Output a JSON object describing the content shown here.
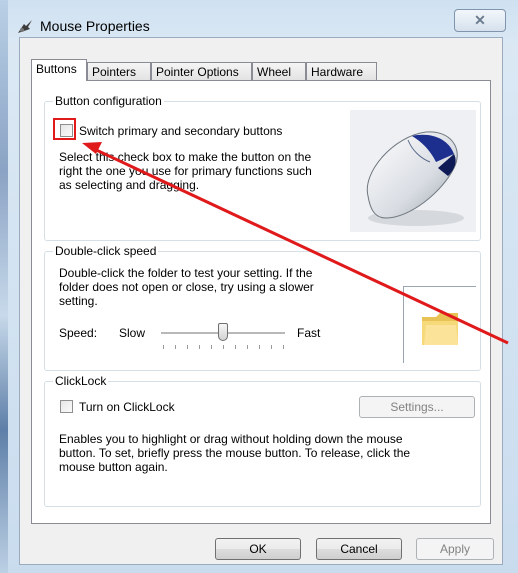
{
  "window": {
    "title": "Mouse Properties",
    "close_label": "✕"
  },
  "tabs": [
    {
      "label": "Buttons",
      "active": true
    },
    {
      "label": "Pointers",
      "active": false
    },
    {
      "label": "Pointer Options",
      "active": false
    },
    {
      "label": "Wheel",
      "active": false
    },
    {
      "label": "Hardware",
      "active": false
    }
  ],
  "button_configuration": {
    "legend": "Button configuration",
    "checkbox_label": "Switch primary and secondary buttons",
    "checked": false,
    "description_lines": [
      "Select this check box to make the button on the",
      "right the one you use for primary functions such",
      "as selecting and dragging."
    ]
  },
  "double_click_speed": {
    "legend": "Double-click speed",
    "description_lines": [
      "Double-click the folder to test your setting. If the",
      "folder does not open or close, try using a slower",
      "setting."
    ],
    "speed_label": "Speed:",
    "slow_label": "Slow",
    "fast_label": "Fast",
    "slider_value_fraction": 0.5
  },
  "clicklock": {
    "legend": "ClickLock",
    "checkbox_label": "Turn on ClickLock",
    "checked": false,
    "settings_button": "Settings...",
    "description_lines": [
      "Enables you to highlight or drag without holding down the mouse",
      "button. To set, briefly press the mouse button. To release, click the",
      "mouse button again."
    ]
  },
  "footer": {
    "ok": "OK",
    "cancel": "Cancel",
    "apply": "Apply"
  },
  "colors": {
    "annotation": "#e0191b"
  }
}
